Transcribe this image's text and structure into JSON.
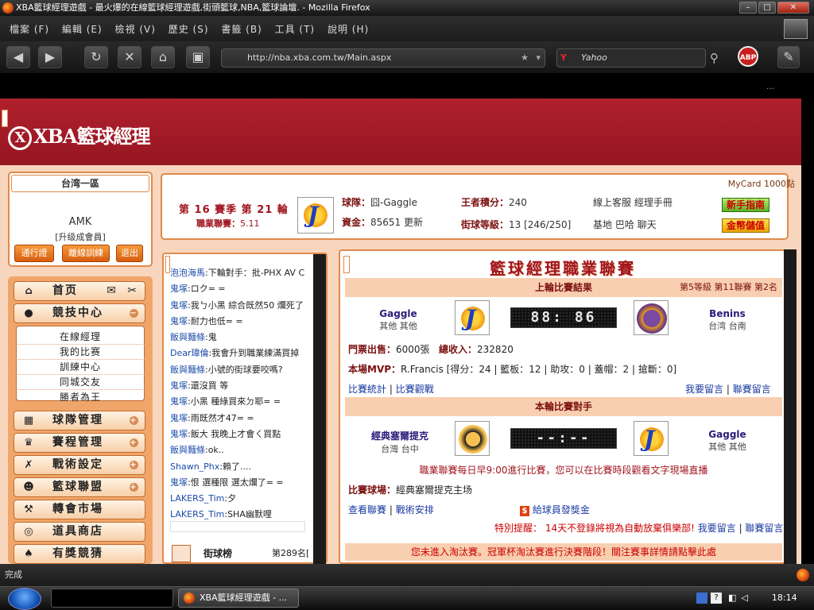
{
  "window": {
    "title": "XBA籃球經理遊戲 - 最火爆的在線籃球經理遊戲,街頭籃球,NBA,籃球論壇. - Mozilla Firefox"
  },
  "menu": [
    "檔案 (F)",
    "編輯 (E)",
    "檢視 (V)",
    "歷史 (S)",
    "書籤 (B)",
    "工具 (T)",
    "說明 (H)"
  ],
  "address": {
    "url": "http://nba.xba.com.tw/Main.aspx",
    "search_placeholder": "Yahoo"
  },
  "addons": {
    "abp_label": "ABP"
  },
  "site": {
    "logo_text": "XBA籃球經理"
  },
  "user": {
    "region": "台湾一區",
    "name": "AMK",
    "role": "[升级成會員]",
    "btn_pass": "通行證",
    "btn_offline": "離線訓練",
    "btn_exit": "退出"
  },
  "leftnav": {
    "home": "首页",
    "compete": "競技中心",
    "sub": [
      "在線經理",
      "我的比赛",
      "訓練中心",
      "同城交友",
      "勝者為王"
    ],
    "items": [
      "球隊管理",
      "賽程管理",
      "戰術設定",
      "籃球聯盟",
      "轉會市場",
      "道具商店",
      "有獎競猜"
    ]
  },
  "info": {
    "mycard": "MyCard 1000點",
    "season": "第 16 賽季 第 21 輪",
    "league_year_label": "職業聯賽：",
    "league_year_value": "5.11",
    "team_label": "球隊：",
    "team_value": "囧-Gaggle",
    "funds_label": "資金：",
    "funds_value": "85651",
    "funds_update": "更新",
    "score_label": "王者積分：",
    "score_value": "240",
    "level_label": "街球等級：",
    "level_value": "13 [246/250]",
    "online_service": "線上客服 經理手冊",
    "base_links": "基地 巴哈 聊天",
    "btn_newbie": "新手指南",
    "btn_gold": "金幣儲值"
  },
  "chat": [
    {
      "n": "泡泡海馬",
      "t": ":下輪對手：批-PHX AV C"
    },
    {
      "n": "鬼塚",
      "t": ":ロク= ="
    },
    {
      "n": "鬼塚",
      "t": ":我ㄅ小黑 綜合既然50 爛死了"
    },
    {
      "n": "鬼塚",
      "t": ":耐力也低= ="
    },
    {
      "n": "飯與麵條",
      "t": ":鬼"
    },
    {
      "n": "Dear瑋倫",
      "t": ":我會升到職業練滿買掉"
    },
    {
      "n": "飯與麵條",
      "t": ":小號的街球要咬嗎?"
    },
    {
      "n": "鬼塚",
      "t": ":還沒買 等"
    },
    {
      "n": "鬼塚",
      "t": ":小黑 種綠買來ㄉ耶= ="
    },
    {
      "n": "鬼塚",
      "t": ":雨既然才47= ="
    },
    {
      "n": "鬼塚",
      "t": ":飯大 我晚上才會ㄑ買點"
    },
    {
      "n": "飯與麵條",
      "t": ":ok.."
    },
    {
      "n": "Shawn_Phx",
      "t": ":賴了...."
    },
    {
      "n": "鬼塚",
      "t": ":恨 選種限 選太爛了= ="
    },
    {
      "n": "LAKERS_Tim",
      "t": ":夕"
    },
    {
      "n": "LAKERS_Tim",
      "t": ":SHA幽默哩"
    }
  ],
  "rank": {
    "label": "街球榜",
    "value": "第289名["
  },
  "main": {
    "title": "籃球經理職業聯賽",
    "last_title": "上輪比賽結果",
    "last_info": "第5等級 第11聯賽 第2名",
    "home_team": "Gaggle",
    "home_loc": "其他 其他",
    "away_team": "Benins",
    "away_loc": "台湾 台南",
    "score": "88: 86",
    "ticket_label": "門票出售：",
    "ticket_value": "6000張",
    "income_label": "總收入：",
    "income_value": "232820",
    "mvp_label": "本場MVP：",
    "mvp_value": "R.Francis [得分：24 | 籃板：12 | 助攻：0 | 蓋帽：2 | 搶斷：0]",
    "link_stats": "比賽統計",
    "link_watch": "比賽觀戰",
    "link_msg": "我要留言",
    "link_league_msg": "聯賽留言",
    "next_title": "本輪比賽對手",
    "next_home": "經典塞爾提克",
    "next_home_loc": "台灣 台中",
    "next_away": "Gaggle",
    "next_away_loc": "其他 其他",
    "next_score": "--:--",
    "schedule_note": "職業聯賽每日早9:00進行比賽，您可以在比賽時段觀看文字現場直播",
    "venue_label": "比賽球場：",
    "venue_value": "經典塞爾提克主场",
    "link_view": "查看聯賽",
    "link_tactic": "戰術安排",
    "bonus": "給球員發獎金",
    "notice": "特別提醒： 14天不登錄將視為自動放棄俱樂部!",
    "link_msg2": "我要留言",
    "link_league_msg2": "聯賽留言",
    "bottom": "您未進入淘汰賽。冠軍杯淘汰賽進行決賽階段！關注賽事詳情請點擊此處"
  },
  "status": {
    "text": "完成"
  },
  "taskbar": {
    "task": "XBA籃球經理遊戲 - ...",
    "clock": "18:14"
  }
}
